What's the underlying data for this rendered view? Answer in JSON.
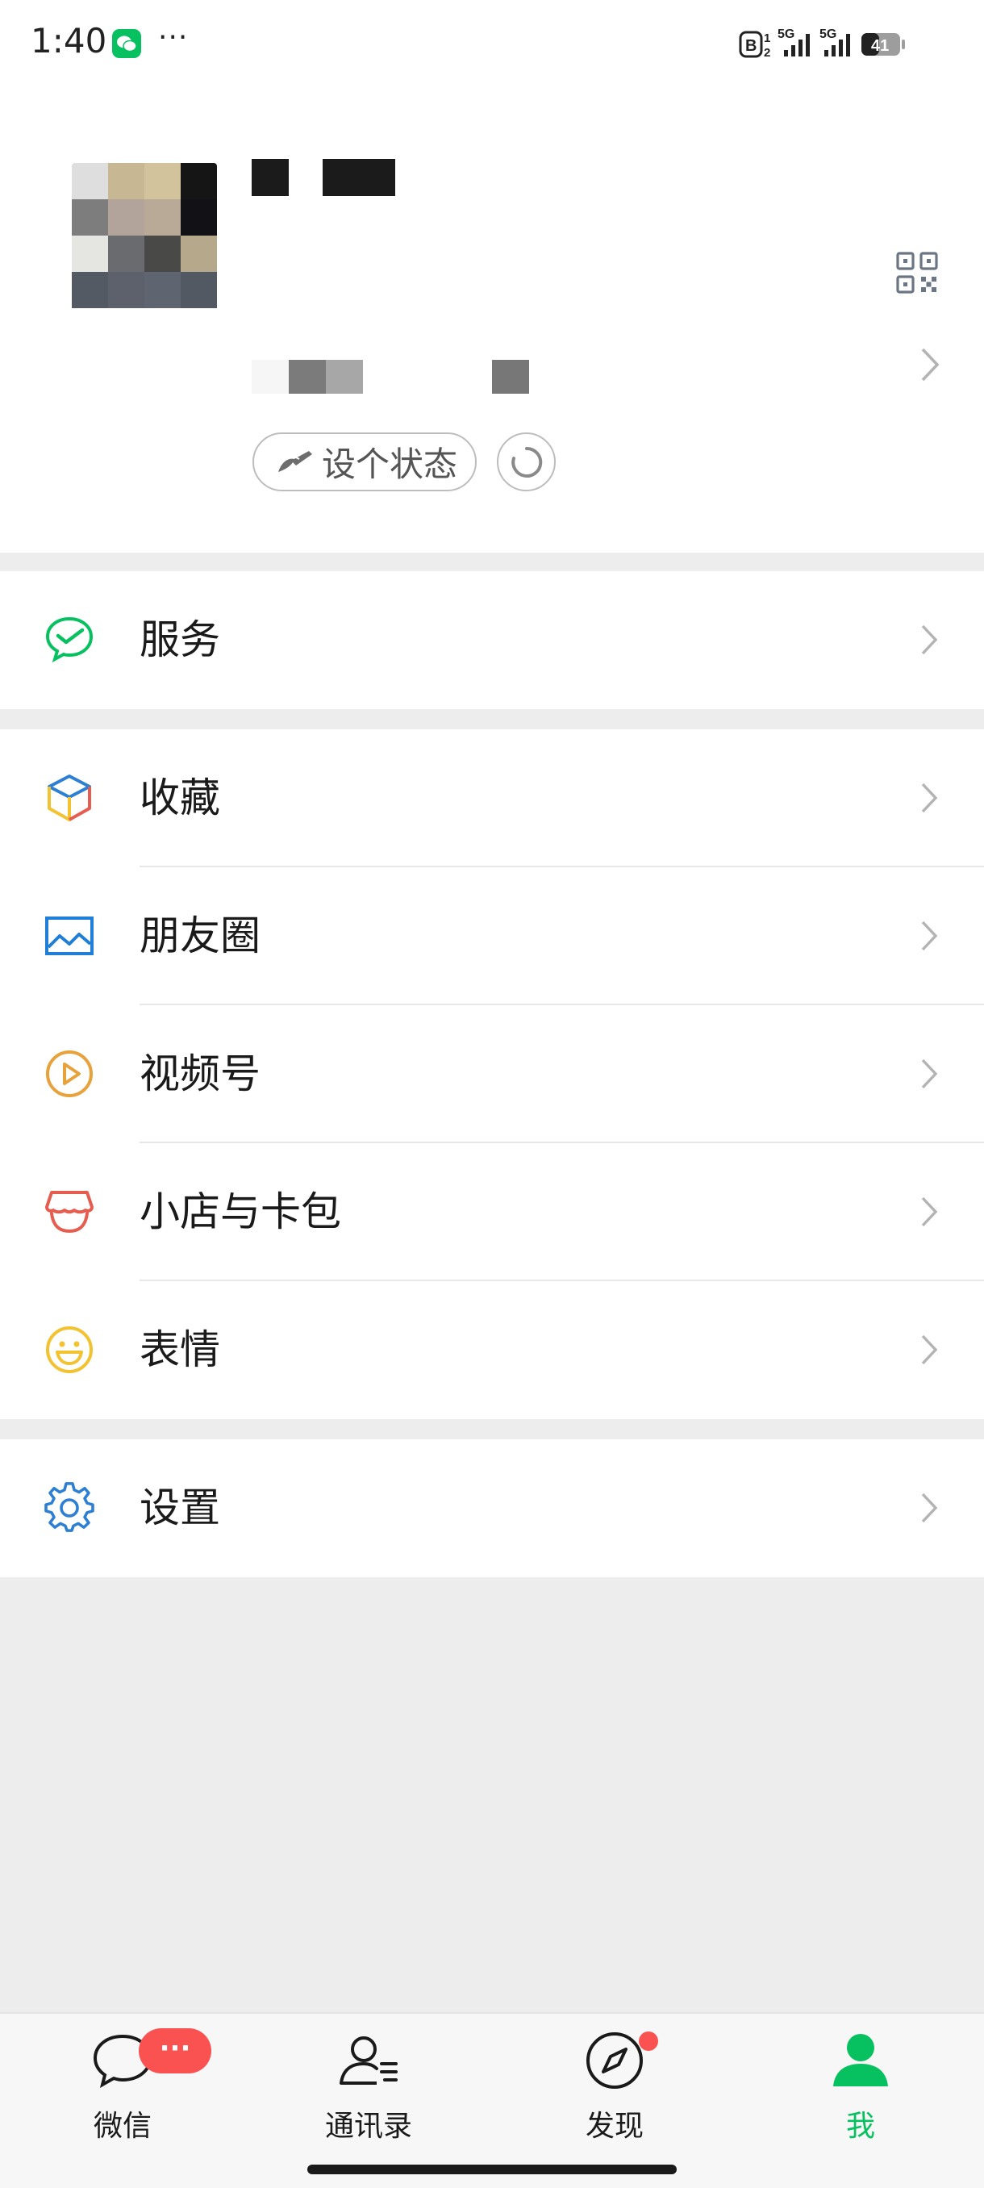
{
  "status_bar": {
    "time": "1:40",
    "more": "···",
    "network_1": "5G",
    "network_2": "5G",
    "sim_badge": "B",
    "sim_sup": "1",
    "sim_sub": "2",
    "battery": "41"
  },
  "profile": {
    "set_status_label": "设个状态",
    "icons": [
      "qr-code-icon",
      "chevron-right-icon",
      "brush-icon",
      "refresh-icon"
    ]
  },
  "menu": {
    "service": {
      "label": "服务",
      "icon": "wechat-pay-icon",
      "color": "#07c160"
    },
    "favorites": {
      "label": "收藏",
      "icon": "cube-icon"
    },
    "moments": {
      "label": "朋友圈",
      "icon": "picture-icon",
      "color": "#1f7ed6"
    },
    "channels": {
      "label": "视频号",
      "icon": "play-circle-icon",
      "color": "#e8a23c"
    },
    "shop": {
      "label": "小店与卡包",
      "icon": "shop-icon",
      "color": "#e65d4f"
    },
    "stickers": {
      "label": "表情",
      "icon": "smiley-icon",
      "color": "#f2c230"
    },
    "settings": {
      "label": "设置",
      "icon": "gear-icon",
      "color": "#2d7fd3"
    }
  },
  "tabbar": {
    "chats": {
      "label": "微信",
      "badge": "···"
    },
    "contacts": {
      "label": "通讯录"
    },
    "discover": {
      "label": "发现"
    },
    "me": {
      "label": "我",
      "active_color": "#07c160"
    }
  }
}
